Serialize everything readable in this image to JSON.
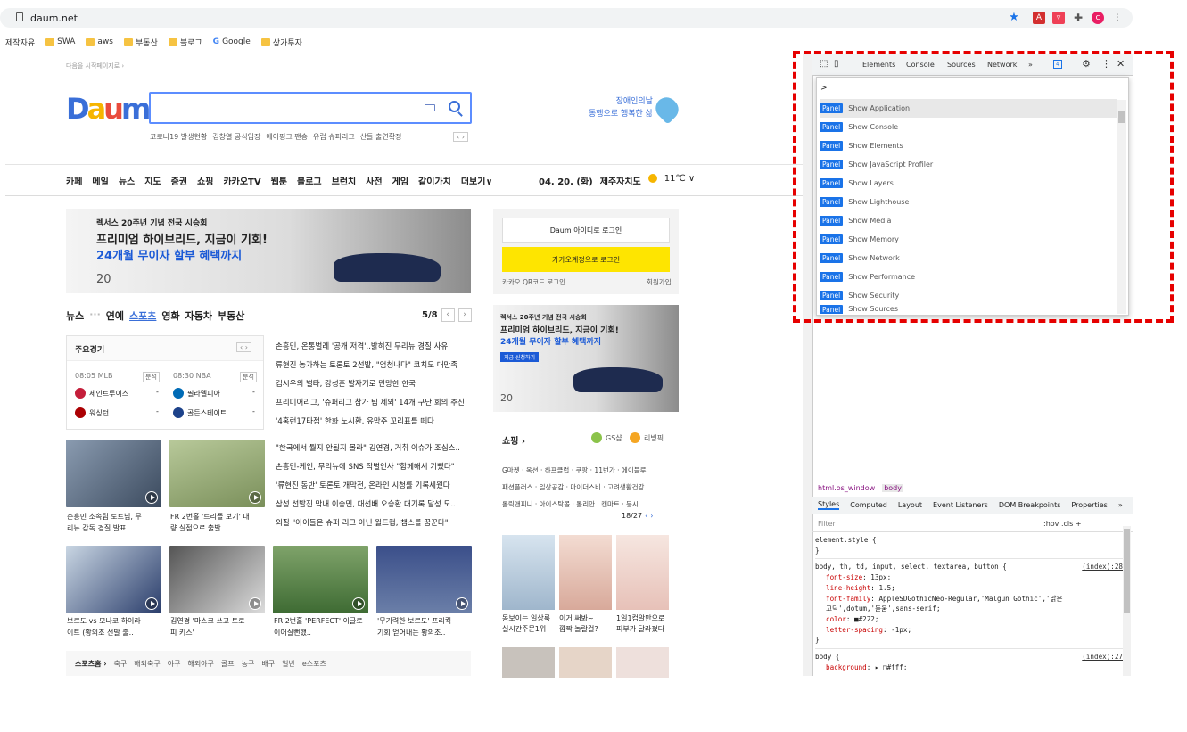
{
  "browser": {
    "url": "daum.net",
    "bookmarks": [
      "제작자유",
      "SWA",
      "aws",
      "부동산",
      "블로그",
      "Google",
      "상가투자"
    ]
  },
  "header": {
    "start_page_link": "다음을 시작페이지로 ›",
    "logo_text": "Daum",
    "trending": [
      "코로나19 발생현황",
      "김창열 공식입장",
      "에이핑크 팬송",
      "유럽 슈퍼리그",
      "산들 출연확정"
    ],
    "trending_nav": "‹ ›",
    "campaign_line1": "장애인의날",
    "campaign_line2": "동행으로 행복한 삶"
  },
  "gnb": {
    "items": [
      "카페",
      "메일",
      "뉴스",
      "지도",
      "증권",
      "쇼핑",
      "카카오TV",
      "웹툰",
      "블로그",
      "브런치",
      "사전",
      "게임",
      "같이가치",
      "더보기∨"
    ],
    "date": "04. 20. (화)",
    "region": "제주자치도",
    "temp": "11℃ ∨"
  },
  "ad_main": {
    "line1": "렉서스 20주년 기념 전국 시승회",
    "line2": "프리미엄 하이브리드, 지금이 기회!",
    "line3": "24개월 무이자 할부 혜택까지",
    "footer": "20"
  },
  "login": {
    "daum_login": "Daum 아이디로 로그인",
    "kakao_login": "카카오계정으로 로그인",
    "qr_login": "카카오 QR코드 로그인",
    "signup": "회원가입"
  },
  "ad_side": {
    "line1": "렉서스 20주년 기념 전국 시승회",
    "line2": "프리미엄 하이브리드, 지금이 기회!",
    "line3": "24개월 무이자 할부 혜택까지",
    "cta": "지금 신청하기",
    "footer": "20"
  },
  "news": {
    "tabs": [
      "뉴스",
      "연예",
      "스포츠",
      "영화",
      "자동차",
      "부동산"
    ],
    "dots": "···",
    "page": "5/8",
    "headlines": [
      "손흥민, 온통벌레 '공개 저격'..밝혀진 무리뉴 경질 사유",
      "류현진 농가하는 토론토 2선발, \"엄청나다\" 코치도 대만족",
      "김시우의 벌타, 강성훈 발자기로 민망한 한국",
      "프리미어리그, '슈퍼리그 참가 팀 제외' 14개 구단 회의 추진",
      "'4홈런17타점' 한화 노시환, 유망주 꼬리표를 떼다"
    ],
    "headlines2": [
      "\"한국에서 뭘지 안될지 몰라\" 김연경, 거취 이슈가 조심스..",
      "손흥민-케인, 무리뉴에 SNS 작별인사 \"함께해서 기뻤다\"",
      "'류현진 동반' 토론토 개막전, 온라인 시청률 기록세웠다",
      "삼성 선발진 막내 이승민, 대선배 오승환 대기록 달성 도..",
      "외질 \"아이들은 슈퍼 리그 아닌 월드컵, 챔스를 꿈꾼다\""
    ],
    "captions": [
      [
        "손흥민 소속팀 토트넘, 무",
        "리뉴 감독 경질 발표"
      ],
      [
        "FR 2번홀 '트리플 보기' 대",
        "량 실점으로 출발.."
      ],
      [
        "보르도 vs 모나코 하이라",
        "이트 (황의조 선발 출.."
      ],
      [
        "김연경 '마스크 쓰고 트로",
        "피 키스'"
      ],
      [
        "FR 2번홀 'PERFECT' 이글로",
        "이어질뻔했.."
      ],
      [
        "'무기력한 보르도' 프리킥",
        "기회 얻어내는 황의조.."
      ]
    ]
  },
  "sports_box": {
    "title": "주요경기",
    "game1_time": "08:05 MLB",
    "game2_time": "08:30 NBA",
    "analysis": "분석",
    "g1_team1": "세인트루이스",
    "g1_team2": "워싱턴",
    "g2_team1": "필라델피아",
    "g2_team2": "골든스테이트",
    "score": "-"
  },
  "sports_bar": {
    "home": "스포츠홈 ›",
    "items": [
      "축구",
      "해외축구",
      "야구",
      "해외야구",
      "골프",
      "농구",
      "배구",
      "일반",
      "e스포츠"
    ]
  },
  "shopping": {
    "title": "쇼핑 ›",
    "gs": "GS샵",
    "living": "리빙픽",
    "links1": "G마켓 · 옥션 · 하프클럽 · 쿠팡 · 11번가 · 에이블루",
    "links2": "패션플러스 · 일상공감 · 마이더스비 · 고려생활건강",
    "links3": "롤릭앤피니 · 아이스탁몰 · 톨리안 · 캔마트 · 등시",
    "page": "18/27",
    "captions": [
      [
        "동보이는 일상룩",
        "실시간주문1위"
      ],
      [
        "이거 써봐~",
        "깜짝 놀랄걸?"
      ],
      [
        "1일1컵알만으로",
        "피부가 달라졌다"
      ]
    ]
  },
  "devtools": {
    "tabs": [
      "Elements",
      "Console",
      "Sources",
      "Network",
      "»"
    ],
    "badge": "4",
    "prompt": ">",
    "panel_badge": "Panel",
    "commands": [
      "Show Application",
      "Show Console",
      "Show Elements",
      "Show JavaScript Profiler",
      "Show Layers",
      "Show Lighthouse",
      "Show Media",
      "Show Memory",
      "Show Network",
      "Show Performance",
      "Show Security",
      "Show Sources"
    ],
    "breadcrumb": [
      "html.os_window",
      "body"
    ],
    "style_tabs": [
      "Styles",
      "Computed",
      "Layout",
      "Event Listeners",
      "DOM Breakpoints",
      "Properties",
      "»"
    ],
    "filter": "Filter",
    "filter_tools": ":hov  .cls  +",
    "css": {
      "rule0": "element.style {",
      "close": "}",
      "rule1_sel": "body, th, td, input, select, textarea, button {",
      "rule1_src": "(index):28",
      "r1p1": "font-size",
      "r1v1": ": 13px;",
      "r1p2": "line-height",
      "r1v2": ": 1.5;",
      "r1p3": "font-family",
      "r1v3": ": AppleSDGothicNeo-Regular,'Malgun Gothic','맑은 고딕',dotum,'돋움',sans-serif;",
      "r1p4": "color",
      "r1v4": ": ■#222;",
      "r1p5": "letter-spacing",
      "r1v5": ": -1px;",
      "rule2_sel": "body {",
      "rule2_src": "(index):27",
      "r2p1": "background",
      "r2v1": ": ▸ □#fff;"
    }
  },
  "colors": {
    "daum_blue": "#3a6fd8",
    "kakao_yellow": "#fee500",
    "devtools_blue": "#1a73e8",
    "annotation_red": "#e60000"
  }
}
